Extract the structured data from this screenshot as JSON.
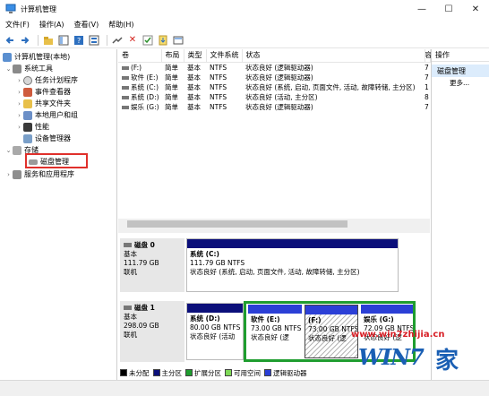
{
  "window": {
    "title": "计算机管理",
    "buttons": {
      "minimize": "—",
      "maximize": "☐",
      "close": "✕"
    }
  },
  "menu": [
    "文件(F)",
    "操作(A)",
    "查看(V)",
    "帮助(H)"
  ],
  "tree": {
    "root": "计算机管理(本地)",
    "system_tools": "系统工具",
    "task_scheduler": "任务计划程序",
    "event_viewer": "事件查看器",
    "shared_folders": "共享文件夹",
    "local_users": "本地用户和组",
    "performance": "性能",
    "device_manager": "设备管理器",
    "storage": "存储",
    "disk_management": "磁盘管理",
    "services_apps": "服务和应用程序"
  },
  "volume_table": {
    "headers": [
      "卷",
      "布局",
      "类型",
      "文件系统",
      "状态",
      "容"
    ],
    "rows": [
      [
        "(F:)",
        "简单",
        "基本",
        "NTFS",
        "状态良好 (逻辑驱动器)",
        "7"
      ],
      [
        "软件 (E:)",
        "简单",
        "基本",
        "NTFS",
        "状态良好 (逻辑驱动器)",
        "7"
      ],
      [
        "系统 (C:)",
        "简单",
        "基本",
        "NTFS",
        "状态良好 (系统, 启动, 页面文件, 活动, 故障转储, 主分区)",
        "1"
      ],
      [
        "系统 (D:)",
        "简单",
        "基本",
        "NTFS",
        "状态良好 (活动, 主分区)",
        "8"
      ],
      [
        "娱乐 (G:)",
        "简单",
        "基本",
        "NTFS",
        "状态良好 (逻辑驱动器)",
        "7"
      ]
    ]
  },
  "disks": [
    {
      "name": "磁盘 0",
      "type": "基本",
      "size": "111.79 GB",
      "status": "联机",
      "partitions": [
        {
          "title": "系统 (C:)",
          "size": "111.79 GB NTFS",
          "status": "状态良好 (系统, 启动, 页面文件, 活动, 故障转储, 主分区)"
        }
      ]
    },
    {
      "name": "磁盘 1",
      "type": "基本",
      "size": "298.09 GB",
      "status": "联机",
      "partitions": [
        {
          "title": "系统 (D:)",
          "size": "80.00 GB NTFS",
          "status": "状态良好 (活动"
        },
        {
          "title": "软件 (E:)",
          "size": "73.00 GB NTFS",
          "status": "状态良好 (逻"
        },
        {
          "title": "(F:)",
          "size": "73.00 GB NTFS",
          "status": "状态良好 (逻"
        },
        {
          "title": "娱乐 (G:)",
          "size": "72.09 GB NTFS",
          "status": "状态良好 (逻"
        }
      ]
    }
  ],
  "legend": [
    {
      "label": "未分配",
      "color": "#000000"
    },
    {
      "label": "主分区",
      "color": "#0b0f7a"
    },
    {
      "label": "扩展分区",
      "color": "#1f9d2f"
    },
    {
      "label": "可用空间",
      "color": "#7ed957"
    },
    {
      "label": "逻辑驱动器",
      "color": "#2b3fd6"
    }
  ],
  "actions": {
    "header": "操作",
    "section": "磁盘管理",
    "more": "更多..."
  },
  "watermark": {
    "url": "www.win7zhijia.cn",
    "logo": "WIN7",
    "suffix": "家"
  }
}
